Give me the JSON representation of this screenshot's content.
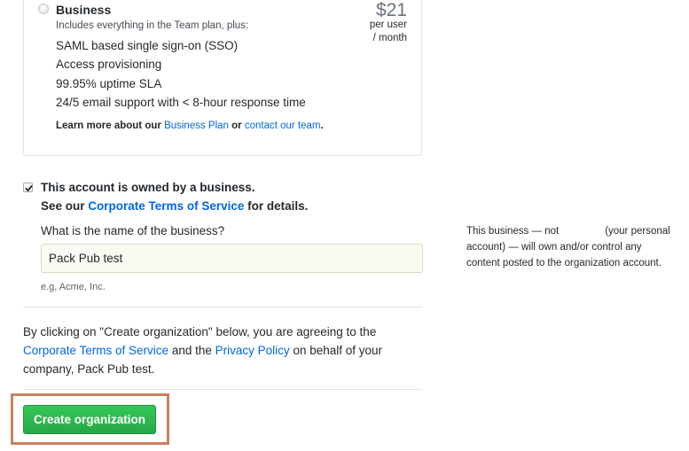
{
  "business_plan": {
    "name": "Business",
    "subtitle": "Includes everything in the Team plan, plus:",
    "price": "$21",
    "per_user": "per user",
    "per_month": "/ month",
    "features": [
      "SAML based single sign-on (SSO)",
      "Access provisioning",
      "99.95% uptime SLA",
      "24/5 email support with < 8-hour response time"
    ],
    "learn_more_prefix": "Learn more about our",
    "business_plan_link": "Business Plan",
    "or_text": "or",
    "contact_link": "contact our team",
    "period": "."
  },
  "ownership": {
    "checked": true,
    "label": "This account is owned by a business.",
    "see_prefix": "See our",
    "terms_link": "Corporate Terms of Service",
    "see_suffix": "for details.",
    "question": "What is the name of the business?",
    "business_name_value": "Pack Pub test",
    "hint": "e.g, Acme, Inc."
  },
  "side_note": {
    "line1_a": "This business — not",
    "line1_b": "(your personal",
    "line2": "account) — will own and/or control any",
    "line3": "content posted to the organization account."
  },
  "agreement": {
    "part1": "By clicking on \"Create organization\" below, you are agreeing to the",
    "terms_link": "Corporate Terms of Service",
    "and_the": "and the",
    "privacy_link": "Privacy Policy",
    "part2": "on behalf of your company, Pack Pub test."
  },
  "create_button": "Create organization",
  "colors": {
    "link": "#0366d6",
    "button_green": "#28a745",
    "highlight_border": "#c9825f"
  }
}
